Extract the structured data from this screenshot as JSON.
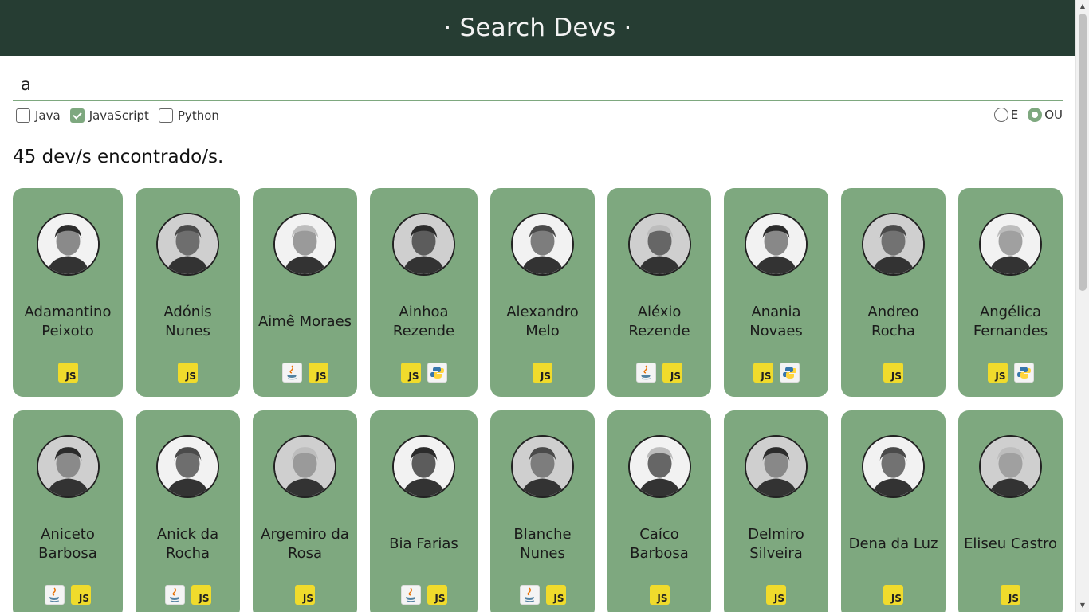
{
  "header": {
    "title": "· Search Devs ·"
  },
  "search": {
    "value": "a"
  },
  "filters": [
    {
      "label": "Java",
      "checked": false
    },
    {
      "label": "JavaScript",
      "checked": true
    },
    {
      "label": "Python",
      "checked": false
    }
  ],
  "logic": [
    {
      "label": "E",
      "checked": false
    },
    {
      "label": "OU",
      "checked": true
    }
  ],
  "results": {
    "count_text": "45 dev/s encontrado/s."
  },
  "colors": {
    "header_bg": "#263d33",
    "card_bg": "#7ea87f",
    "accent": "#7ea87f",
    "js_badge": "#f0db2c"
  },
  "devs": [
    {
      "name": "Adamantino Peixoto",
      "langs": [
        "js"
      ],
      "photo": "grayscale-portrait"
    },
    {
      "name": "Adónis Nunes",
      "langs": [
        "js"
      ],
      "photo": "grayscale-portrait"
    },
    {
      "name": "Aimê Moraes",
      "langs": [
        "java",
        "js"
      ],
      "photo": "grayscale-portrait"
    },
    {
      "name": "Ainhoa Rezende",
      "langs": [
        "js",
        "python"
      ],
      "photo": "grayscale-portrait"
    },
    {
      "name": "Alexandro Melo",
      "langs": [
        "js"
      ],
      "photo": "grayscale-portrait"
    },
    {
      "name": "Aléxio Rezende",
      "langs": [
        "java",
        "js"
      ],
      "photo": "grayscale-portrait"
    },
    {
      "name": "Anania Novaes",
      "langs": [
        "js",
        "python"
      ],
      "photo": "grayscale-portrait"
    },
    {
      "name": "Andreo Rocha",
      "langs": [
        "js"
      ],
      "photo": "grayscale-portrait"
    },
    {
      "name": "Angélica Fernandes",
      "langs": [
        "js",
        "python"
      ],
      "photo": "grayscale-portrait"
    },
    {
      "name": "Aniceto Barbosa",
      "langs": [
        "java",
        "js"
      ],
      "photo": "grayscale-portrait"
    },
    {
      "name": "Anick da Rocha",
      "langs": [
        "java",
        "js"
      ],
      "photo": "grayscale-portrait"
    },
    {
      "name": "Argemiro da Rosa",
      "langs": [
        "js"
      ],
      "photo": "grayscale-portrait"
    },
    {
      "name": "Bia Farias",
      "langs": [
        "java",
        "js"
      ],
      "photo": "grayscale-portrait"
    },
    {
      "name": "Blanche Nunes",
      "langs": [
        "java",
        "js"
      ],
      "photo": "grayscale-portrait"
    },
    {
      "name": "Caíco Barbosa",
      "langs": [
        "js"
      ],
      "photo": "grayscale-portrait"
    },
    {
      "name": "Delmiro Silveira",
      "langs": [
        "js"
      ],
      "photo": "grayscale-portrait"
    },
    {
      "name": "Dena da Luz",
      "langs": [
        "js"
      ],
      "photo": "grayscale-portrait"
    },
    {
      "name": "Eliseu Castro",
      "langs": [
        "js"
      ],
      "photo": "grayscale-portrait"
    }
  ],
  "icons": {
    "java": "java-icon",
    "js": "javascript-icon",
    "python": "python-icon"
  }
}
